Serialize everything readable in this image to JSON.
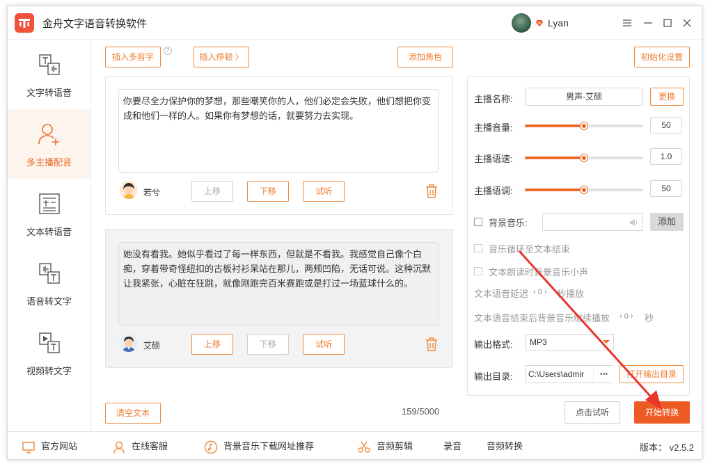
{
  "app": {
    "title": "金舟文字语音转换软件",
    "user_name": "Lyan"
  },
  "sidebar": {
    "items": [
      {
        "label": "文字转语音",
        "icon": "text-to-speech-icon"
      },
      {
        "label": "多主播配音",
        "icon": "multi-anchor-icon",
        "active": true
      },
      {
        "label": "文本转语音",
        "icon": "document-to-speech-icon"
      },
      {
        "label": "语音转文字",
        "icon": "speech-to-text-icon"
      },
      {
        "label": "视频转文字",
        "icon": "video-to-text-icon"
      }
    ]
  },
  "toolbar": {
    "insert_polyphone": "插入多音字",
    "insert_pause": "插入停顿 〉",
    "add_role": "添加角色",
    "init_settings": "初始化设置"
  },
  "cards": [
    {
      "text": "你要尽全力保护你的梦想，那些嘲笑你的人，他们必定会失败，他们想把你变成和他们一样的人。如果你有梦想的话，就要努力去实现。",
      "speaker": "若兮",
      "move_up": "上移",
      "move_down": "下移",
      "listen": "试听"
    },
    {
      "text": "她没有看我。她似乎看过了每一样东西，但就是不看我。我感觉自己像个白痴，穿着带奇怪纽扣的古板衬衫呆站在那儿，两颊凹陷，无话可说。这种沉默让我紧张，心脏在狂跳，就像刚跑完百米赛跑或是打过一场蓝球什么的。",
      "speaker": "艾硕",
      "move_up": "上移",
      "move_down": "下移",
      "listen": "试听"
    }
  ],
  "clear_text": "清空文本",
  "char_counter": "159/5000",
  "settings": {
    "anchor_name_label": "主播名称:",
    "anchor_name_value": "男声-艾硕",
    "change_label": "更换",
    "volume_label": "主播音量:",
    "volume_value": "50",
    "volume_level": 0.5,
    "speed_label": "主播语速:",
    "speed_value": "1.0",
    "speed_level": 0.5,
    "pitch_label": "主播语调:",
    "pitch_value": "50",
    "pitch_level": 0.5,
    "bgm_label": "背景音乐:",
    "add_label": "添加",
    "loop_label": "音乐循环至文本结束",
    "lower_label": "文本朗读时背景音乐小声",
    "delay_label": "文本语音延迟",
    "delay_value": "0",
    "delay_unit": "秒播放",
    "continue_label": "文本语音结束后背景音乐继续播放",
    "continue_value": "0",
    "continue_unit": "秒",
    "format_label": "输出格式:",
    "format_value": "MP3",
    "dir_label": "输出目录:",
    "dir_value": "C:\\Users\\admir",
    "dir_more": "•••",
    "open_dir": "打开输出目录"
  },
  "actions": {
    "try_listen": "点击试听",
    "start": "开始转换"
  },
  "bottom": {
    "website": "官方网站",
    "service": "在线客服",
    "bgm_download": "背景音乐下载网址推荐",
    "audio_edit": "音频剪辑",
    "record": "录音",
    "audio_convert": "音频转换",
    "version": "版本： v2.5.2"
  },
  "colors": {
    "accent": "#ee6a2b",
    "start": "#ee5a24",
    "arrow": "#e8362b"
  }
}
